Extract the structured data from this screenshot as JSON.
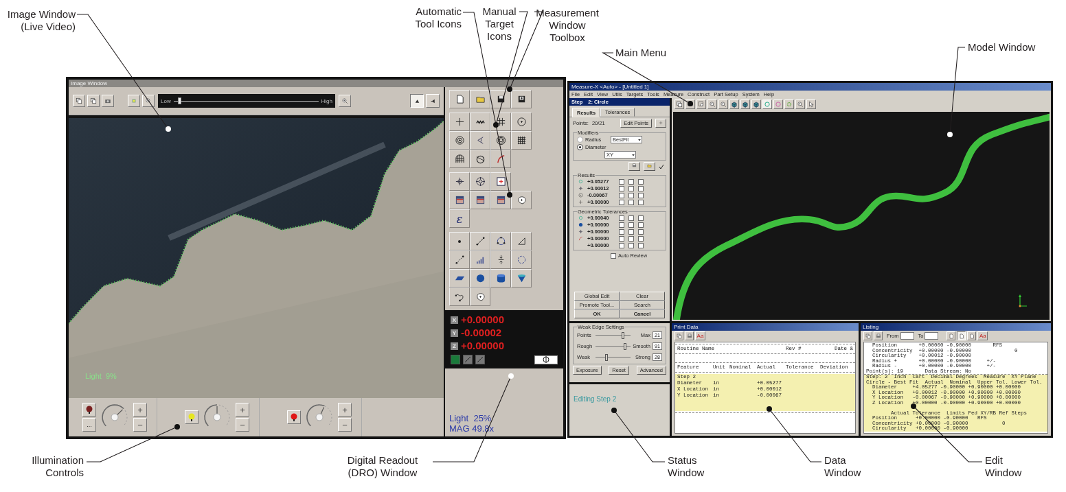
{
  "callouts": [
    {
      "lines": [
        "Image Window",
        "(Live Video)"
      ]
    },
    {
      "lines": [
        "Automatic",
        "Tool Icons"
      ]
    },
    {
      "lines": [
        "Manual",
        "Target",
        "Icons"
      ]
    },
    {
      "lines": [
        "Measurement",
        "Window",
        "Toolbox"
      ]
    },
    {
      "lines": [
        "Main Menu"
      ]
    },
    {
      "lines": [
        "Model Window"
      ]
    },
    {
      "lines": [
        "Illumination",
        "Controls"
      ]
    },
    {
      "lines": [
        "Digital Readout",
        "(DRO) Window"
      ]
    },
    {
      "lines": [
        "Status",
        "Window"
      ]
    },
    {
      "lines": [
        "Data",
        "Window"
      ]
    },
    {
      "lines": [
        "Edit",
        "Window"
      ]
    }
  ],
  "image_window": {
    "title": "Image Window",
    "slider": {
      "low": "Low",
      "high": "High",
      "level": 0.03
    },
    "view_toggles": [
      {
        "selected": true
      },
      {
        "selected": false
      }
    ],
    "overlay": "Light  9%",
    "illumination": [
      {
        "color": "#7a2020",
        "level": 0.67,
        "plus": "+",
        "minus": "−",
        "extra": "..."
      },
      {
        "color": "#e6e620",
        "level": 0.5,
        "plus": "+",
        "minus": "−"
      },
      {
        "color": "#e01818",
        "level": 0.59,
        "plus": "+",
        "minus": "−"
      }
    ]
  },
  "toolbox": {
    "epsilon": "ε",
    "dro": [
      {
        "axis": "X",
        "value": "+0.00000"
      },
      {
        "axis": "Y",
        "value": "-0.00002"
      },
      {
        "axis": "Z",
        "value": "+0.00000"
      }
    ],
    "status": [
      "Light  25%",
      "MAG 49.8x"
    ]
  },
  "measure_app": {
    "title": "Measure-X <Auto> - [Untitled 1]",
    "menu": [
      "File",
      "Edit",
      "View",
      "Utils",
      "Targets",
      "Tools",
      "Measure",
      "Construct",
      "Part Setup",
      "System",
      "Help"
    ],
    "step": {
      "label": "Step",
      "name": "2: Circle"
    },
    "tabs": [
      {
        "label": "Results",
        "selected": true
      },
      {
        "label": "Tolerances",
        "selected": false
      }
    ],
    "points": {
      "label": "Points:",
      "value": "20/21",
      "button": "Edit Points"
    },
    "modifiers": {
      "title": "Modifiers",
      "options": [
        {
          "label": "Radius",
          "selected": false
        },
        {
          "label": "Diameter",
          "selected": true
        }
      ],
      "fit": "BestFit",
      "plane": "XY"
    },
    "results": {
      "title": "Results",
      "rows": [
        {
          "value": "+0.05277",
          "checks": [
            false,
            false,
            false
          ]
        },
        {
          "value": "+0.00012",
          "checks": [
            false,
            false,
            false
          ]
        },
        {
          "value": "-0.00067",
          "checks": [
            false,
            false,
            false
          ]
        },
        {
          "value": "+0.00000",
          "checks": [
            false,
            false,
            false
          ]
        }
      ]
    },
    "geometric": {
      "title": "Geometric Tolerances",
      "rows": [
        {
          "value": "+0.00040",
          "checks": [
            false,
            false,
            false
          ]
        },
        {
          "value": "+0.00000",
          "checks": [
            false,
            false,
            false
          ]
        },
        {
          "value": "+0.00000",
          "checks": [
            false,
            false,
            false
          ]
        },
        {
          "value": "+0.00000",
          "checks": [
            false,
            false,
            false
          ]
        },
        {
          "value": "+0.00000",
          "checks": [
            false,
            false,
            false
          ]
        }
      ]
    },
    "auto_review": {
      "label": "Auto Review",
      "checked": false
    },
    "buttons": [
      "Global Edit",
      "Clear",
      "Promote Tool...",
      "Search",
      "OK",
      "Cancel"
    ],
    "edge_settings": {
      "title": "Weak Edge Settings",
      "sliders": [
        {
          "label": "Points",
          "end": "Max",
          "value": "21",
          "level": 0.8
        },
        {
          "label": "Rough",
          "end": "Smooth",
          "value": "91",
          "level": 0.87
        },
        {
          "label": "Weak",
          "end": "Strong",
          "value": "28",
          "level": 0.3
        }
      ],
      "buttons": [
        "Exposure",
        "Reset",
        "Advanced"
      ]
    },
    "status": "Editing Step 2",
    "print_data": {
      "title": "Print Data",
      "font_button": "Aa",
      "routine": {
        "name": "Routine Name",
        "rev": "Rev #",
        "date": "Date &"
      },
      "columns": [
        "Feature",
        "Unit",
        "Nominal",
        "Actual",
        "Tolerance",
        "Deviation"
      ],
      "step": "Step 2",
      "rows": [
        {
          "feature": "Diameter",
          "unit": "in",
          "actual": "+0.05277"
        },
        {
          "feature": "X Location",
          "unit": "in",
          "actual": "+0.00012"
        },
        {
          "feature": "Y Location",
          "unit": "in",
          "actual": "-0.00067"
        }
      ]
    },
    "listing": {
      "title": "Listing",
      "from": "From",
      "to": "To",
      "font_button": "Aa",
      "lines": [
        {
          "kind": "text",
          "text": "  Position       +0.00000 -0.90000       RFS",
          "highlight": false
        },
        {
          "kind": "text",
          "text": "  Concentricity  +0.00000 -0.90000              0",
          "highlight": false
        },
        {
          "kind": "text",
          "text": "  Circularity    +0.00012 -0.90000",
          "highlight": false
        },
        {
          "kind": "text",
          "text": "  Radius +       +0.00000 -0.90000     +/-",
          "highlight": false
        },
        {
          "kind": "text",
          "text": "  Radius -       +0.00000 -0.90000     +/-",
          "highlight": false
        },
        {
          "kind": "text",
          "text": "Point(s): 19       Data Stream: No",
          "highlight": false
        },
        {
          "kind": "text",
          "text": "Step: 2  Inch  Cart  Decimal Degrees  Measure  XY Plane",
          "highlight": true
        },
        {
          "kind": "text",
          "text": "Circle - Best Fit  Actual  Nominal  Upper Tol. Lower Tol.",
          "highlight": true
        },
        {
          "kind": "text",
          "text": "  Diameter     +4.05277 -0.90000 +0.90000 +0.00000",
          "highlight": true
        },
        {
          "kind": "text",
          "text": "  X Location   +0.00012 -0.90000 +0.90000 +0.00000",
          "highlight": true
        },
        {
          "kind": "text",
          "text": "  Y Location   -0.00067 -0.90000 +0.90000 +0.00000",
          "highlight": true
        },
        {
          "kind": "text",
          "text": "  Z Location   +0.00000 -0.90000 +0.90000 +0.00000",
          "highlight": true
        },
        {
          "kind": "blank",
          "highlight": true
        },
        {
          "kind": "text",
          "text": "        Actual Tolerance  Limits Fed XY/RB Ref Steps",
          "highlight": true
        },
        {
          "kind": "text",
          "text": "  Position      +0.00000 -0.90000   RFS",
          "highlight": true
        },
        {
          "kind": "text",
          "text": "  Concentricity +0.00000 -0.90000           0",
          "highlight": true
        },
        {
          "kind": "text",
          "text": "  Circularity   +0.00000 -0.90000",
          "highlight": true
        }
      ]
    }
  }
}
